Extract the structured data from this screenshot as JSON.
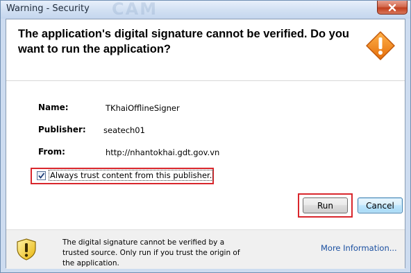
{
  "window": {
    "title": "Warning - Security",
    "watermark": "CAM"
  },
  "header": {
    "headline": "The application's digital signature cannot be verified. Do you want to run the application?"
  },
  "details": {
    "name_label": "Name:",
    "name_value": "TKhaiOfflineSigner",
    "publisher_label": "Publisher:",
    "publisher_value": "seatech01",
    "from_label": "From:",
    "from_value": "http://nhantokhai.gdt.gov.vn"
  },
  "trust_checkbox": {
    "label": "Always trust content from this publisher.",
    "checked": true
  },
  "buttons": {
    "run": "Run",
    "cancel": "Cancel"
  },
  "footer": {
    "message": "The digital signature cannot be verified by a trusted source.  Only run if you trust the origin of the application.",
    "more_info": "More Information..."
  },
  "colors": {
    "highlight_red": "#d9262c",
    "warning_orange": "#f08a1c",
    "shield_yellow": "#f7d23a",
    "link_blue": "#1a4fa0"
  },
  "icons": {
    "close": "close-icon",
    "warning": "warning-diamond-icon",
    "shield": "shield-warning-icon",
    "check": "check-icon"
  }
}
